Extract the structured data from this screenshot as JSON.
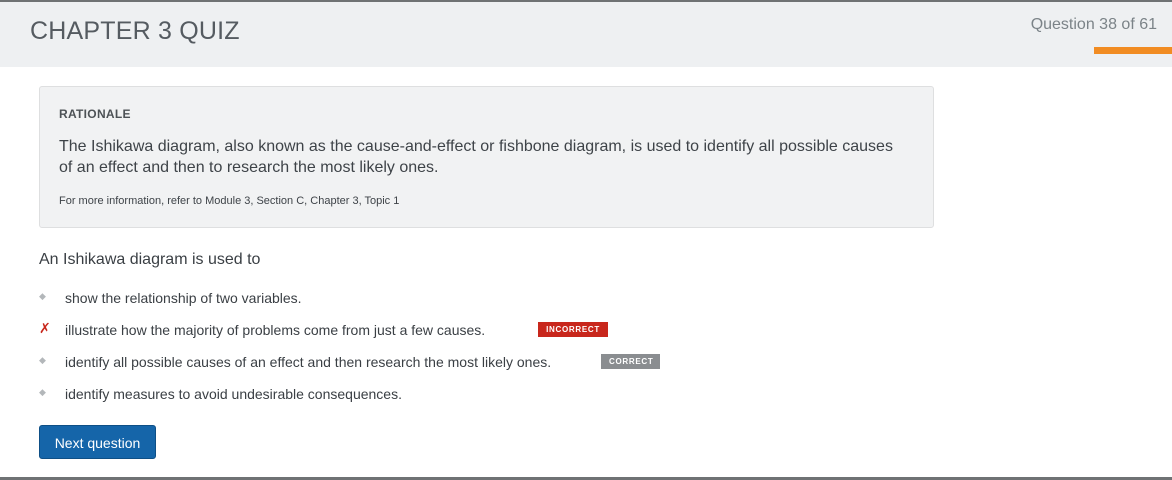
{
  "header": {
    "title": "CHAPTER 3 QUIZ",
    "counter": "Question 38 of 61",
    "progress": 0.62,
    "accent_color": "#f18c23"
  },
  "rationale": {
    "title": "RATIONALE",
    "body": "The Ishikawa diagram, also known as the cause-and-effect or fishbone diagram, is used to identify all possible causes of an effect and then to research the most likely ones.",
    "reference": "For more information, refer to Module 3, Section C, Chapter 3, Topic 1"
  },
  "question": {
    "text": "An Ishikawa diagram is used to",
    "answers": [
      {
        "text": "show the relationship of two variables.",
        "marker": "◆",
        "status": ""
      },
      {
        "text": "illustrate how the majority of problems come from just a few causes.",
        "marker": "✗",
        "status": "INCORRECT"
      },
      {
        "text": "identify all possible causes of an effect and then research the most likely ones.",
        "marker": "◆",
        "status": "CORRECT"
      },
      {
        "text": "identify measures to avoid undesirable consequences.",
        "marker": "◆",
        "status": ""
      }
    ]
  },
  "actions": {
    "next_label": "Next question"
  },
  "colors": {
    "incorrect": "#c8271c",
    "correct": "#8a8d90",
    "button": "#1565a9"
  }
}
